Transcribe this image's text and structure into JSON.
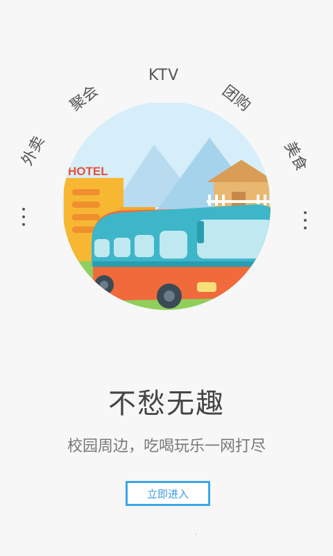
{
  "categories": {
    "ktv": "KTV",
    "juhui": "聚会",
    "tuangou": "团购",
    "waimai": "外卖",
    "meishi": "美食"
  },
  "illustration": {
    "hotel_sign": "HOTEL"
  },
  "headline": "不愁无趣",
  "subline": "校园周边，吃喝玩乐一网打尽",
  "enter_button_label": "立即进入",
  "colors": {
    "accent": "#3ba6e8",
    "background": "#f7f7f7",
    "bus_body": "#f06a3c",
    "bus_roof": "#3db6c9",
    "hotel": "#f7b733",
    "sky": "#cfeaf7",
    "grass": "#8ccf5a"
  },
  "icons": {
    "left_more": "vertical-dots-icon",
    "right_more": "vertical-dots-icon"
  }
}
